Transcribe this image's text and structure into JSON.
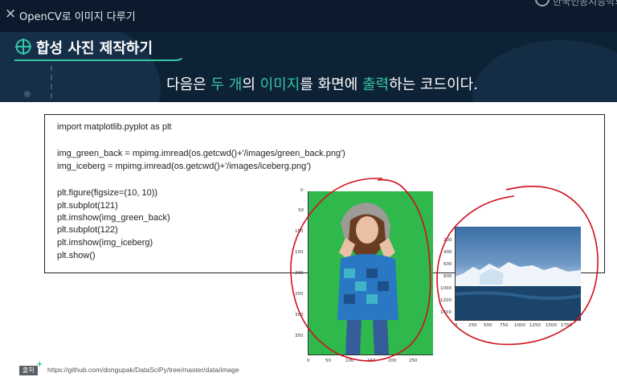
{
  "window": {
    "close_glyph": "×",
    "course_title": "OpenCV로 이미지 다루기",
    "logo_text": "한국인공지능학회"
  },
  "section": {
    "icon": "crosshair-target-icon",
    "title": "합성 사진 제작하기"
  },
  "subtitle": {
    "parts": [
      {
        "text": "다음은 ",
        "highlight": false
      },
      {
        "text": "두 개",
        "highlight": true
      },
      {
        "text": "의 ",
        "highlight": false
      },
      {
        "text": "이미지",
        "highlight": true
      },
      {
        "text": "를 화면에 ",
        "highlight": false
      },
      {
        "text": "출력",
        "highlight": true
      },
      {
        "text": "하는 코드이다.",
        "highlight": false
      }
    ],
    "highlight_color": "#33c6a4"
  },
  "code": {
    "lines": [
      "import matplotlib.pyplot as plt",
      "",
      "img_green_back = mpimg.imread(os.getcwd()+'/images/green_back.png')",
      "img_iceberg = mpimg.imread(os.getcwd()+'/images/iceberg.png')",
      "",
      "plt.figure(figsize=(10, 10))",
      "plt.subplot(121)",
      "plt.imshow(img_green_back)",
      "plt.subplot(122)",
      "plt.imshow(img_iceberg)",
      "plt.show()"
    ]
  },
  "plot_left": {
    "image": "woman-green-background",
    "y_ticks": [
      "0",
      "50",
      "100",
      "150",
      "200",
      "250",
      "300",
      "350"
    ],
    "x_ticks": [
      "0",
      "50",
      "100",
      "150",
      "200",
      "250"
    ]
  },
  "plot_right": {
    "image": "iceberg",
    "y_ticks": [
      "200",
      "400",
      "600",
      "800",
      "1000",
      "1200",
      "1400"
    ],
    "x_ticks": [
      "0",
      "250",
      "500",
      "750",
      "1000",
      "1250",
      "1500",
      "1750"
    ]
  },
  "annotation_color": "#d0101c",
  "source": {
    "badge": "출처",
    "url": "https://github.com/dongupak/DataSciPy/tree/master/data/image"
  },
  "colors": {
    "header_bg": "#0e2236",
    "green_screen": "#2fb84b"
  }
}
